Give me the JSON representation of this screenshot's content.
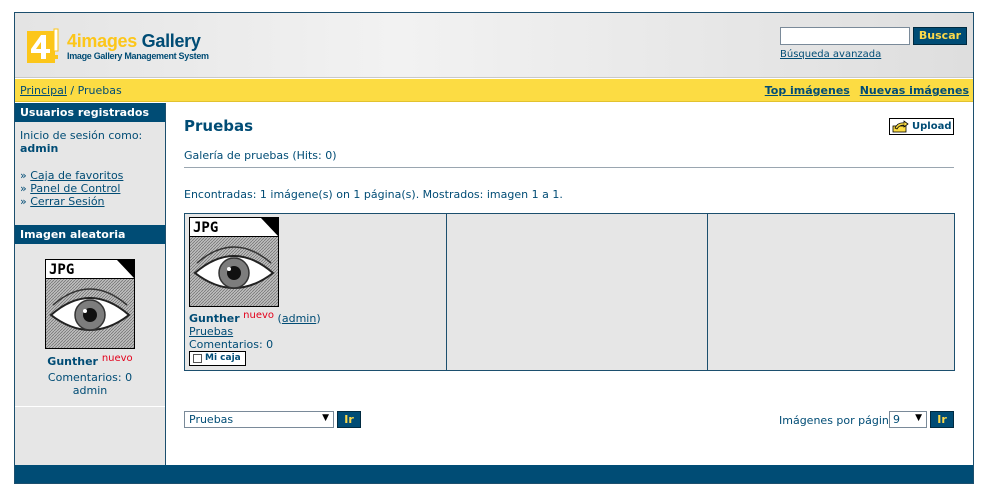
{
  "header": {
    "logo_text_brand": "4images",
    "logo_text_rest": " Gallery",
    "logo_subtitle": "Image Gallery Management System",
    "search_value": "",
    "search_button": "Buscar",
    "advanced_search": "Búsqueda avanzada"
  },
  "navbar": {
    "breadcrumb_home": "Principal",
    "breadcrumb_separator": " / ",
    "breadcrumb_current": "Pruebas",
    "top_images": "Top imágenes",
    "new_images": "Nuevas imágenes"
  },
  "sidebar": {
    "registered_heading": "Usuarios registrados",
    "logged_as_label": "Inicio de sesión como:",
    "username": "admin",
    "links": [
      "Caja de favoritos",
      "Panel de Control",
      "Cerrar Sesión"
    ],
    "link_prefix": "» ",
    "random_heading": "Imagen aleatoria",
    "random_image": {
      "badge": "JPG",
      "name": "Gunther",
      "new_label": "nuevo",
      "comments": "Comentarios: 0",
      "user": "admin"
    }
  },
  "main": {
    "title": "Pruebas",
    "upload_button": "Upload",
    "description": "Galería de pruebas (Hits: 0)",
    "found_text": "Encontradas: 1 imágene(s) on 1 página(s). Mostrados: imagen 1 a 1.",
    "items": [
      {
        "badge": "JPG",
        "name": "Gunther",
        "new_label": "nuevo",
        "user": "admin",
        "category": "Pruebas",
        "comments": "Comentarios: 0",
        "lightbox_label": "Mi caja"
      }
    ],
    "category_select": "Pruebas",
    "go_button": "Ir",
    "per_page_label": "Imágenes por página:",
    "per_page_value": "9"
  },
  "colors": {
    "primary": "#004c75",
    "accent": "#fcdc43",
    "new_badge": "#e3001b"
  }
}
